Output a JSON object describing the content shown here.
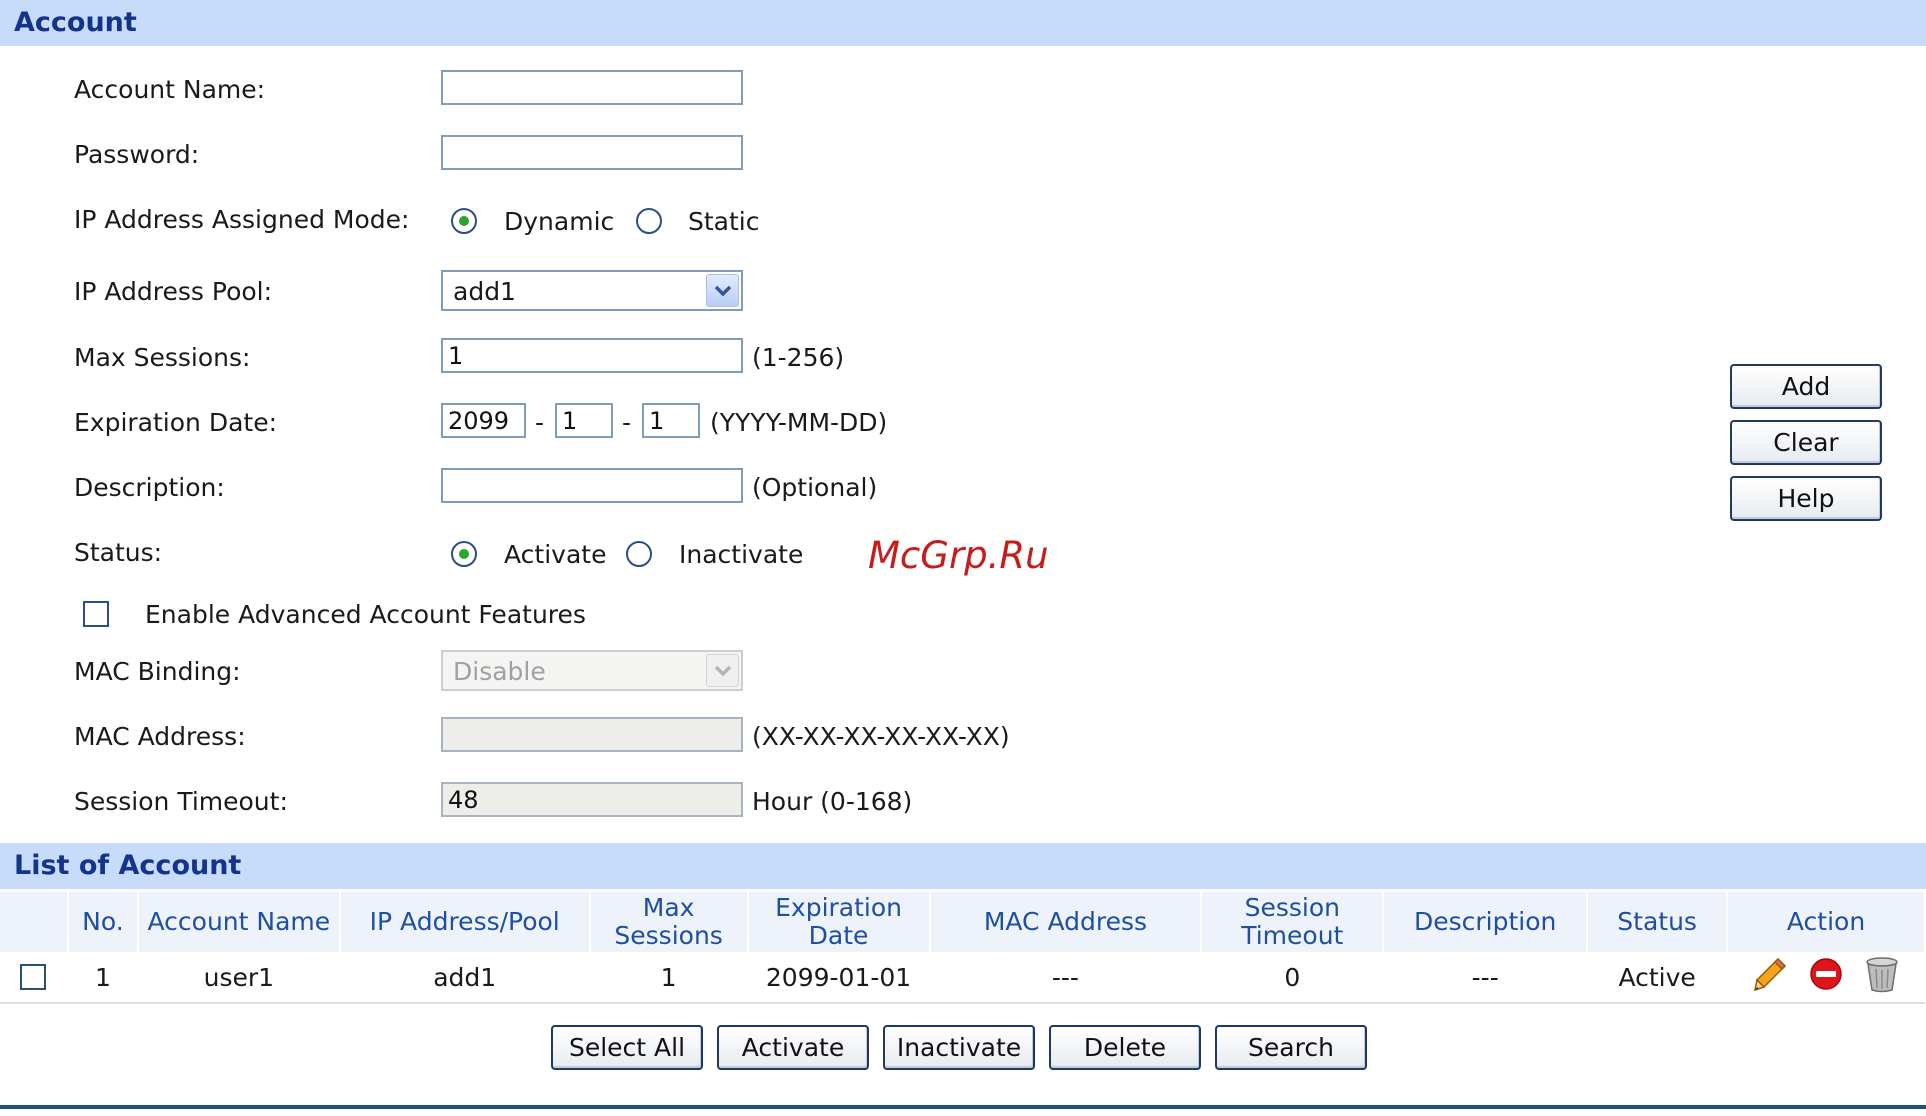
{
  "account_section": {
    "title": "Account",
    "account_name": {
      "label": "Account Name:",
      "value": ""
    },
    "password": {
      "label": "Password:",
      "value": ""
    },
    "ip_mode": {
      "label": "IP Address Assigned Mode:",
      "options": [
        "Dynamic",
        "Static"
      ],
      "selected": "Dynamic"
    },
    "ip_pool": {
      "label": "IP Address Pool:",
      "value": "add1"
    },
    "max_sessions": {
      "label": "Max Sessions:",
      "value": "1",
      "hint": "(1-256)"
    },
    "expiration": {
      "label": "Expiration Date:",
      "year": "2099",
      "month": "1",
      "day": "1",
      "sep": "-",
      "hint": "(YYYY-MM-DD)"
    },
    "description": {
      "label": "Description:",
      "value": "",
      "hint": "(Optional)"
    },
    "status": {
      "label": "Status:",
      "options": [
        "Activate",
        "Inactivate"
      ],
      "selected": "Activate"
    },
    "advanced": {
      "label": "Enable Advanced Account Features",
      "checked": false
    },
    "mac_binding": {
      "label": "MAC Binding:",
      "value": "Disable"
    },
    "mac_address": {
      "label": "MAC Address:",
      "value": "",
      "hint": "(XX-XX-XX-XX-XX-XX)"
    },
    "session_timeout": {
      "label": "Session Timeout:",
      "value": "48",
      "hint": "Hour (0-168)"
    },
    "buttons": {
      "add": "Add",
      "clear": "Clear",
      "help": "Help"
    }
  },
  "watermark": "McGrp.Ru",
  "list_section": {
    "title": "List of Account",
    "columns": [
      "No.",
      "Account Name",
      "IP Address/Pool",
      "Max Sessions",
      "Expiration Date",
      "MAC Address",
      "Session Timeout",
      "Description",
      "Status",
      "Action"
    ],
    "rows": [
      {
        "no": "1",
        "account_name": "user1",
        "ip_pool": "add1",
        "max_sessions": "1",
        "expiration": "2099-01-01",
        "mac": "---",
        "session_timeout": "0",
        "description": "---",
        "status": "Active",
        "actions": [
          "edit-icon",
          "disable-icon",
          "delete-icon"
        ]
      }
    ],
    "buttons": {
      "select_all": "Select All",
      "activate": "Activate",
      "inactivate": "Inactivate",
      "delete": "Delete",
      "search": "Search"
    }
  },
  "colors": {
    "section_bar": "#c7dcfb",
    "section_title": "#14338a",
    "header_text": "#1e4fa0",
    "radio_dot": "#2ba52b",
    "watermark": "#c81b1b"
  }
}
